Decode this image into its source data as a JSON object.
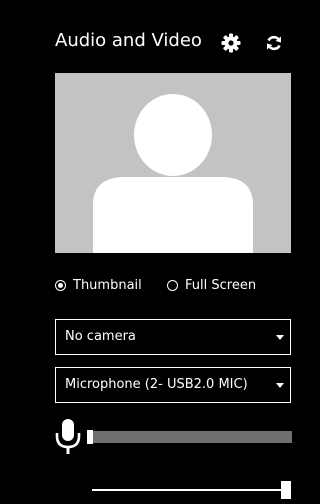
{
  "panel": {
    "title": "Audio and Video",
    "settings_icon": "gear-icon",
    "refresh_icon": "refresh-icon"
  },
  "preview": {
    "icon": "person-silhouette-icon",
    "background_color": "#c3c3c3"
  },
  "view_mode": {
    "options": [
      {
        "label": "Thumbnail",
        "selected": true
      },
      {
        "label": "Full Screen",
        "selected": false
      }
    ]
  },
  "camera_select": {
    "value": "No camera"
  },
  "microphone_select": {
    "value": "Microphone (2- USB2.0 MIC)"
  },
  "mic_level": {
    "icon": "microphone-icon",
    "level": 0.02
  },
  "volume_slider": {
    "level": 1.0
  }
}
